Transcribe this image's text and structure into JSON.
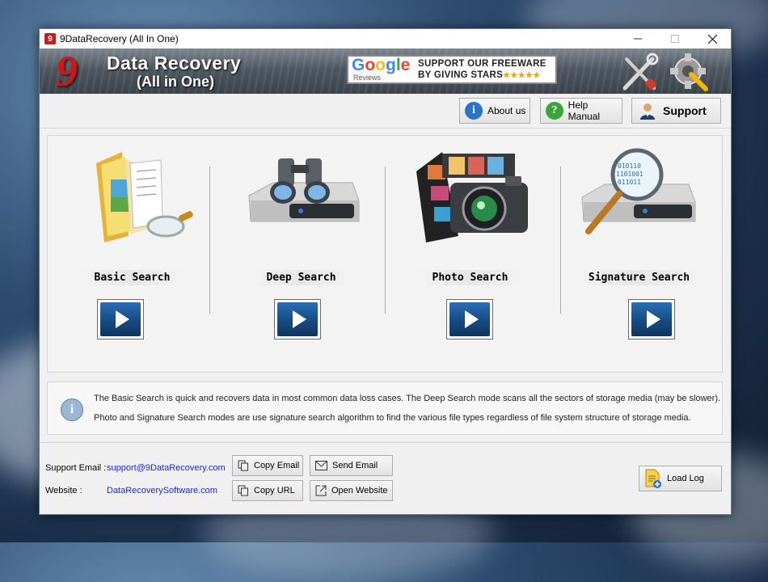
{
  "window": {
    "title": "9DataRecovery (All In One)"
  },
  "banner": {
    "brand_line1": "Data Recovery",
    "brand_line2": "(All in One)",
    "google_word": "Google",
    "google_sub": "Reviews",
    "promo_line1": "SUPPORT OUR FREEWARE",
    "promo_line2": "BY GIVING STARS",
    "stars": "★★★★★"
  },
  "toolbar": {
    "about_label": "About us",
    "help_label": "Help Manual",
    "support_label": "Support"
  },
  "search_modes": [
    {
      "label": "Basic Search"
    },
    {
      "label": "Deep Search"
    },
    {
      "label": "Photo Search"
    },
    {
      "label": "Signature Search"
    }
  ],
  "info": {
    "line1": "The Basic Search is quick and recovers data in most common data loss cases. The Deep Search mode scans all the sectors of storage media (may be slower).",
    "line2": "Photo and Signature Search modes are use signature search algorithm to find the various file types regardless of file system structure of storage media."
  },
  "footer": {
    "email_label": "Support Email :",
    "email_value": "support@9DataRecovery.com",
    "website_label": "Website :",
    "website_value": "DataRecoverySoftware.com",
    "copy_email": "Copy Email",
    "send_email": "Send Email",
    "copy_url": "Copy URL",
    "open_website": "Open Website",
    "load_log": "Load Log"
  },
  "colors": {
    "brand_red": "#d21616",
    "link_blue": "#1a2bc4",
    "play_blue": "#174a82"
  }
}
